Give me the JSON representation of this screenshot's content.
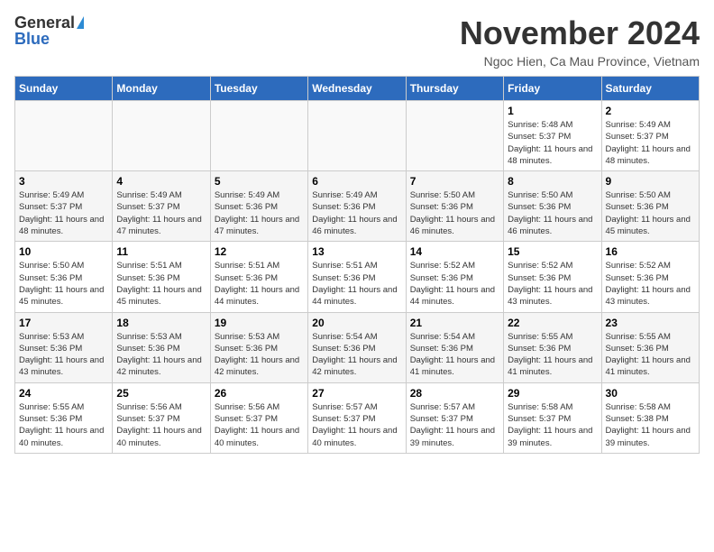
{
  "header": {
    "logo_general": "General",
    "logo_blue": "Blue",
    "title": "November 2024",
    "subtitle": "Ngoc Hien, Ca Mau Province, Vietnam"
  },
  "weekdays": [
    "Sunday",
    "Monday",
    "Tuesday",
    "Wednesday",
    "Thursday",
    "Friday",
    "Saturday"
  ],
  "weeks": [
    [
      {
        "day": "",
        "info": ""
      },
      {
        "day": "",
        "info": ""
      },
      {
        "day": "",
        "info": ""
      },
      {
        "day": "",
        "info": ""
      },
      {
        "day": "",
        "info": ""
      },
      {
        "day": "1",
        "info": "Sunrise: 5:48 AM\nSunset: 5:37 PM\nDaylight: 11 hours and 48 minutes."
      },
      {
        "day": "2",
        "info": "Sunrise: 5:49 AM\nSunset: 5:37 PM\nDaylight: 11 hours and 48 minutes."
      }
    ],
    [
      {
        "day": "3",
        "info": "Sunrise: 5:49 AM\nSunset: 5:37 PM\nDaylight: 11 hours and 48 minutes."
      },
      {
        "day": "4",
        "info": "Sunrise: 5:49 AM\nSunset: 5:37 PM\nDaylight: 11 hours and 47 minutes."
      },
      {
        "day": "5",
        "info": "Sunrise: 5:49 AM\nSunset: 5:36 PM\nDaylight: 11 hours and 47 minutes."
      },
      {
        "day": "6",
        "info": "Sunrise: 5:49 AM\nSunset: 5:36 PM\nDaylight: 11 hours and 46 minutes."
      },
      {
        "day": "7",
        "info": "Sunrise: 5:50 AM\nSunset: 5:36 PM\nDaylight: 11 hours and 46 minutes."
      },
      {
        "day": "8",
        "info": "Sunrise: 5:50 AM\nSunset: 5:36 PM\nDaylight: 11 hours and 46 minutes."
      },
      {
        "day": "9",
        "info": "Sunrise: 5:50 AM\nSunset: 5:36 PM\nDaylight: 11 hours and 45 minutes."
      }
    ],
    [
      {
        "day": "10",
        "info": "Sunrise: 5:50 AM\nSunset: 5:36 PM\nDaylight: 11 hours and 45 minutes."
      },
      {
        "day": "11",
        "info": "Sunrise: 5:51 AM\nSunset: 5:36 PM\nDaylight: 11 hours and 45 minutes."
      },
      {
        "day": "12",
        "info": "Sunrise: 5:51 AM\nSunset: 5:36 PM\nDaylight: 11 hours and 44 minutes."
      },
      {
        "day": "13",
        "info": "Sunrise: 5:51 AM\nSunset: 5:36 PM\nDaylight: 11 hours and 44 minutes."
      },
      {
        "day": "14",
        "info": "Sunrise: 5:52 AM\nSunset: 5:36 PM\nDaylight: 11 hours and 44 minutes."
      },
      {
        "day": "15",
        "info": "Sunrise: 5:52 AM\nSunset: 5:36 PM\nDaylight: 11 hours and 43 minutes."
      },
      {
        "day": "16",
        "info": "Sunrise: 5:52 AM\nSunset: 5:36 PM\nDaylight: 11 hours and 43 minutes."
      }
    ],
    [
      {
        "day": "17",
        "info": "Sunrise: 5:53 AM\nSunset: 5:36 PM\nDaylight: 11 hours and 43 minutes."
      },
      {
        "day": "18",
        "info": "Sunrise: 5:53 AM\nSunset: 5:36 PM\nDaylight: 11 hours and 42 minutes."
      },
      {
        "day": "19",
        "info": "Sunrise: 5:53 AM\nSunset: 5:36 PM\nDaylight: 11 hours and 42 minutes."
      },
      {
        "day": "20",
        "info": "Sunrise: 5:54 AM\nSunset: 5:36 PM\nDaylight: 11 hours and 42 minutes."
      },
      {
        "day": "21",
        "info": "Sunrise: 5:54 AM\nSunset: 5:36 PM\nDaylight: 11 hours and 41 minutes."
      },
      {
        "day": "22",
        "info": "Sunrise: 5:55 AM\nSunset: 5:36 PM\nDaylight: 11 hours and 41 minutes."
      },
      {
        "day": "23",
        "info": "Sunrise: 5:55 AM\nSunset: 5:36 PM\nDaylight: 11 hours and 41 minutes."
      }
    ],
    [
      {
        "day": "24",
        "info": "Sunrise: 5:55 AM\nSunset: 5:36 PM\nDaylight: 11 hours and 40 minutes."
      },
      {
        "day": "25",
        "info": "Sunrise: 5:56 AM\nSunset: 5:37 PM\nDaylight: 11 hours and 40 minutes."
      },
      {
        "day": "26",
        "info": "Sunrise: 5:56 AM\nSunset: 5:37 PM\nDaylight: 11 hours and 40 minutes."
      },
      {
        "day": "27",
        "info": "Sunrise: 5:57 AM\nSunset: 5:37 PM\nDaylight: 11 hours and 40 minutes."
      },
      {
        "day": "28",
        "info": "Sunrise: 5:57 AM\nSunset: 5:37 PM\nDaylight: 11 hours and 39 minutes."
      },
      {
        "day": "29",
        "info": "Sunrise: 5:58 AM\nSunset: 5:37 PM\nDaylight: 11 hours and 39 minutes."
      },
      {
        "day": "30",
        "info": "Sunrise: 5:58 AM\nSunset: 5:38 PM\nDaylight: 11 hours and 39 minutes."
      }
    ]
  ]
}
